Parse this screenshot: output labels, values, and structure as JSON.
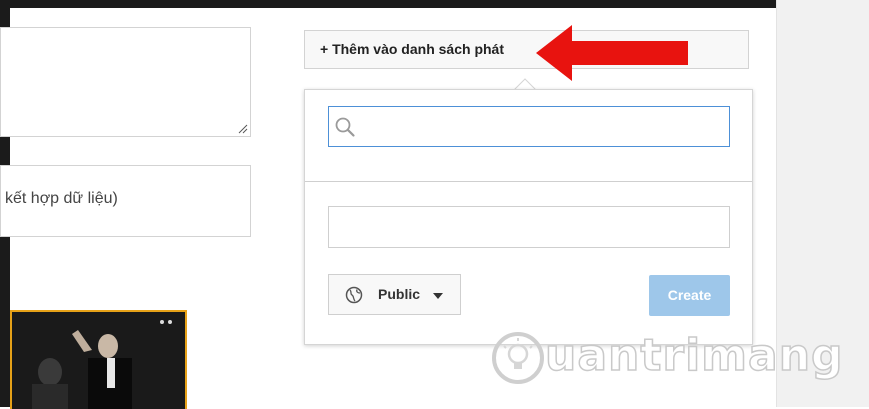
{
  "form": {
    "meta_text": "kết hợp dữ liệu)"
  },
  "playlist": {
    "add_button_label": "+ Thêm vào danh sách phát",
    "search_placeholder": "",
    "name_placeholder": "",
    "privacy_label": "Public",
    "create_label": "Create"
  },
  "icons": {
    "search": "search-icon",
    "globe": "globe-icon",
    "dropdown": "dropdown-arrow-icon",
    "annotation": "red-arrow-icon"
  },
  "watermark": {
    "text": "uantrimang"
  },
  "colors": {
    "accent_blue": "#4d90d7",
    "create_disabled": "#9ec7ea",
    "annotation_red": "#e8130f",
    "thumb_border": "#e6a118"
  }
}
